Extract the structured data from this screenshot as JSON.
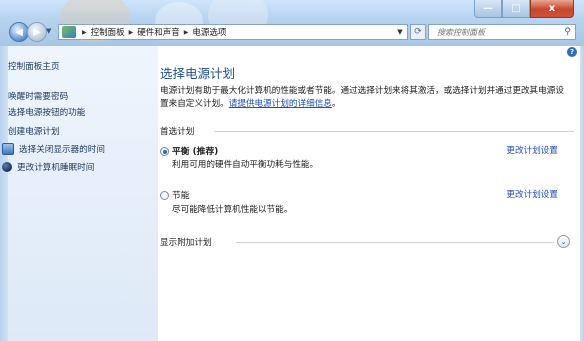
{
  "breadcrumb": {
    "items": [
      "控制面板",
      "硬件和声音",
      "电源选项"
    ]
  },
  "search": {
    "placeholder": "搜索控制面板"
  },
  "window_controls": {
    "minimize": "—",
    "maximize": "□",
    "close": "x"
  },
  "sidebar": {
    "items": [
      {
        "label": "控制面板主页",
        "icon": ""
      },
      {
        "label": "唤醒时需要密码",
        "icon": ""
      },
      {
        "label": "选择电源按钮的功能",
        "icon": ""
      },
      {
        "label": "创建电源计划",
        "icon": ""
      },
      {
        "label": "选择关闭显示器的时间",
        "icon": "monitor-icon"
      },
      {
        "label": "更改计算机睡眠时间",
        "icon": "moon-icon"
      }
    ]
  },
  "main": {
    "title": "选择电源计划",
    "description": "电源计划有助于最大化计算机的性能或者节能。通过选择计划来将其激活，或选择计划并通过更改其电源设置来自定义计划。",
    "description_link": "请提供电源计划的详细信息",
    "description_end": "。",
    "preferred_group": "首选计划",
    "plans": [
      {
        "name": "平衡 (推荐)",
        "desc": "利用可用的硬件自动平衡功耗与性能。",
        "link": "更改计划设置",
        "selected": true
      },
      {
        "name": "节能",
        "desc": "尽可能降低计算机性能以节能。",
        "link": "更改计划设置",
        "selected": false
      }
    ],
    "additional_group": "显示附加计划"
  },
  "colors": {
    "accent": "#1c4fbd",
    "heading": "#1e4f91",
    "sidebar_bg": "#e6eff9"
  }
}
